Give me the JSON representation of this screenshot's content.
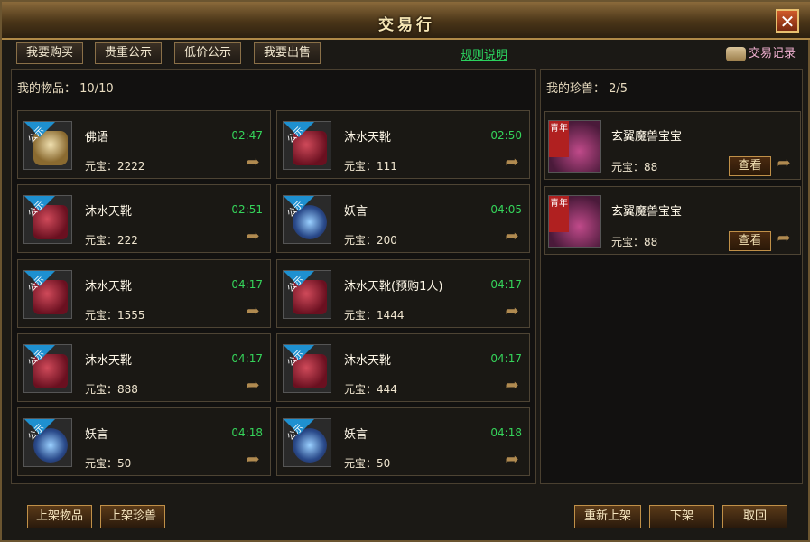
{
  "window": {
    "title": "交易行",
    "close_label": "✕"
  },
  "tabs": [
    "我要购买",
    "贵重公示",
    "低价公示",
    "我要出售"
  ],
  "rules_link": "规则说明",
  "trade_record": "交易记录",
  "left_panel": {
    "label": "我的物品：",
    "count": "10/10",
    "items": [
      {
        "name": "佛语",
        "time": "02:47",
        "price": "元宝：2222",
        "icon": "buddha-icon",
        "badge": "公示"
      },
      {
        "name": "沐水天靴",
        "time": "02:50",
        "price": "元宝：111",
        "icon": "boots-icon",
        "badge": "公示"
      },
      {
        "name": "沐水天靴",
        "time": "02:51",
        "price": "元宝：222",
        "icon": "boots-icon",
        "badge": "公示"
      },
      {
        "name": "妖言",
        "time": "04:05",
        "price": "元宝：200",
        "icon": "ring-icon",
        "badge": "公示"
      },
      {
        "name": "沐水天靴",
        "time": "04:17",
        "price": "元宝：1555",
        "icon": "boots-icon",
        "badge": "公示"
      },
      {
        "name": "沐水天靴(预购1人)",
        "time": "04:17",
        "price": "元宝：1444",
        "icon": "boots-icon",
        "badge": "公示"
      },
      {
        "name": "沐水天靴",
        "time": "04:17",
        "price": "元宝：888",
        "icon": "boots-icon",
        "badge": "公示"
      },
      {
        "name": "沐水天靴",
        "time": "04:17",
        "price": "元宝：444",
        "icon": "boots-icon",
        "badge": "公示"
      },
      {
        "name": "妖言",
        "time": "04:18",
        "price": "元宝：50",
        "icon": "ring-icon",
        "badge": "公示"
      },
      {
        "name": "妖言",
        "time": "04:18",
        "price": "元宝：50",
        "icon": "ring-icon",
        "badge": "公示"
      }
    ]
  },
  "right_panel": {
    "label": "我的珍兽：",
    "count": "2/5",
    "pets": [
      {
        "name": "玄翼魔兽宝宝",
        "price": "元宝：88",
        "view_label": "查看",
        "ribbon": "青年"
      },
      {
        "name": "玄翼魔兽宝宝",
        "price": "元宝：88",
        "view_label": "查看",
        "ribbon": "青年"
      }
    ]
  },
  "bottom_buttons": {
    "list_item": "上架物品",
    "list_pet": "上架珍兽",
    "relist": "重新上架",
    "delist": "下架",
    "cancel": "取回"
  },
  "colors": {
    "timer": "#35d35a",
    "link": "#2bd15e",
    "badge": "#1e90d0"
  }
}
